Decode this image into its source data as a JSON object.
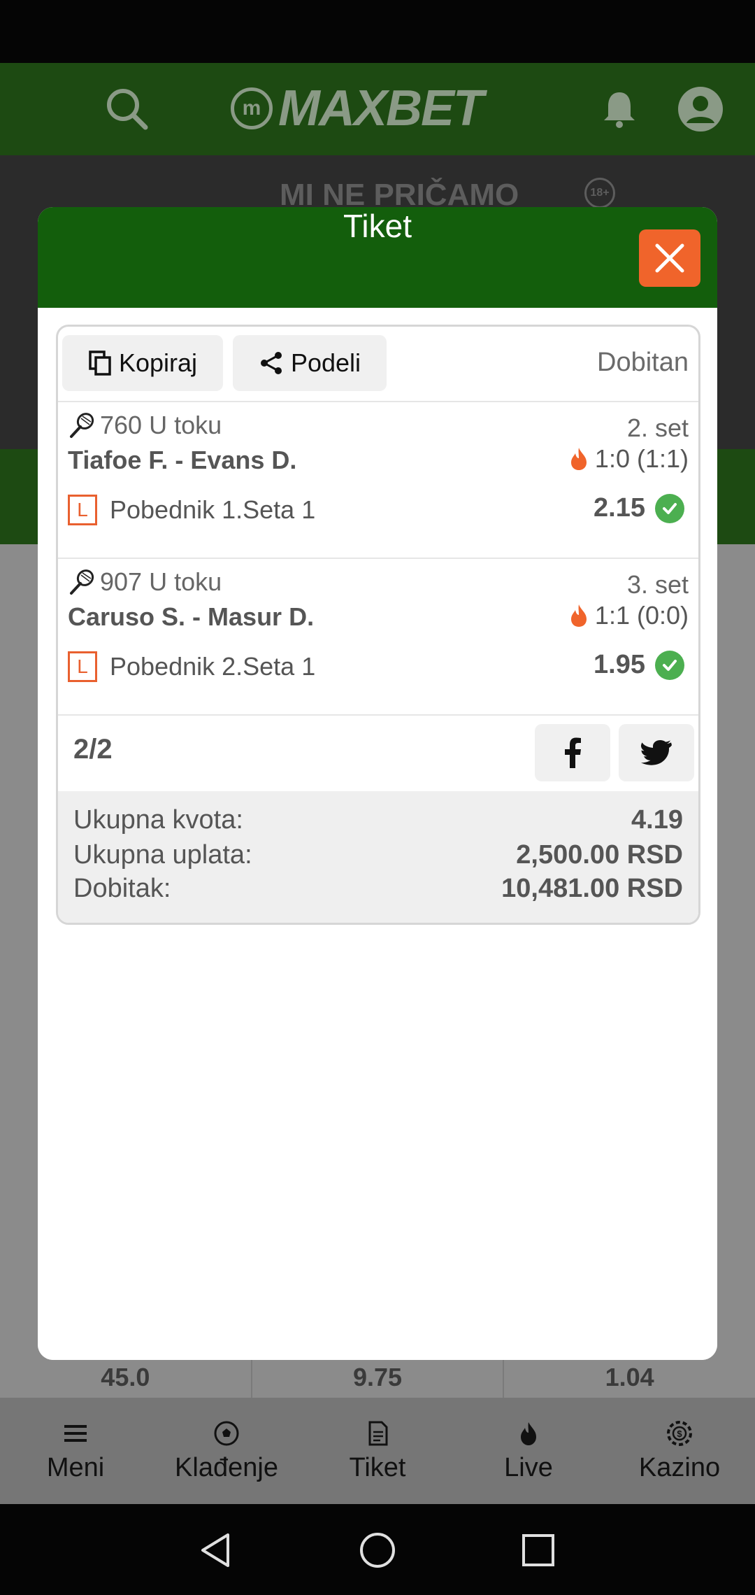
{
  "app": {
    "brand": "MAXBET",
    "banner_text": "MI NE PRIČAMO",
    "age_badge": "18+"
  },
  "background_odds": [
    "45.0",
    "9.75",
    "1.04"
  ],
  "bottom_nav": [
    {
      "label": "Meni",
      "icon": "menu-icon"
    },
    {
      "label": "Klađenje",
      "icon": "soccer-ball-icon"
    },
    {
      "label": "Tiket",
      "icon": "ticket-icon"
    },
    {
      "label": "Live",
      "icon": "flame-icon"
    },
    {
      "label": "Kazino",
      "icon": "casino-chip-icon"
    }
  ],
  "modal": {
    "title": "Tiket",
    "copy_label": "Kopiraj",
    "share_label": "Podeli",
    "status": "Dobitan",
    "matches": [
      {
        "code": "760 U toku",
        "set": "2. set",
        "teams": "Tiafoe F. - Evans D.",
        "score": "1:0 (1:1)",
        "badge": "L",
        "pick": "Pobednik 1.Seta 1",
        "odd": "2.15"
      },
      {
        "code": "907 U toku",
        "set": "3. set",
        "teams": "Caruso S. - Masur D.",
        "score": "1:1 (0:0)",
        "badge": "L",
        "pick": "Pobednik 2.Seta 1",
        "odd": "1.95"
      }
    ],
    "count": "2/2",
    "summary": {
      "total_odds_label": "Ukupna kvota:",
      "total_odds_value": "4.19",
      "stake_label": "Ukupna uplata:",
      "stake_value": "2,500.00 RSD",
      "win_label": "Dobitak:",
      "win_value": "10,481.00 RSD"
    }
  },
  "colors": {
    "header_green": "#135e0c",
    "close_orange": "#f0642b",
    "check_green": "#4caf50",
    "badge_orange": "#e9602f"
  }
}
